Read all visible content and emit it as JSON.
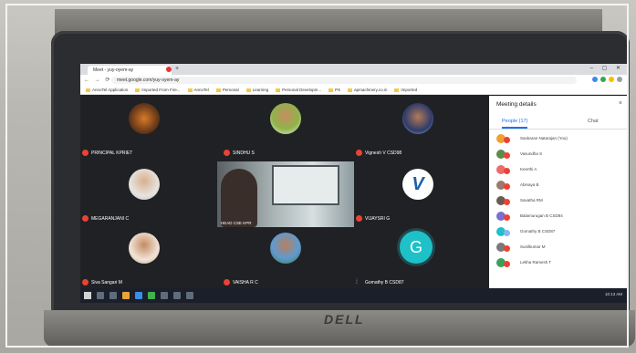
{
  "browser": {
    "tab_title": "Meet - yuy-oyem-ay",
    "url": "meet.google.com/yuy-oyem-ay",
    "bookmarks": [
      "AnnoTel Application",
      "Imported From Fire...",
      "AnnoTel",
      "Personal",
      "Learning",
      "Personal Developm...",
      "PS",
      "apmachinery.co.in",
      "Imported"
    ]
  },
  "meeting": {
    "tiles": [
      {
        "name": "PRINCIPAL KPRIET"
      },
      {
        "name": "SINDHU S"
      },
      {
        "name": "Vignesh V CSD98"
      },
      {
        "name": "MEGARANJANI C"
      },
      {
        "name": "VIJAYSRI G"
      },
      {
        "name": "Siva Sangari M"
      },
      {
        "name": "VAISHA R C"
      },
      {
        "name": "Gomathy B CSD87"
      }
    ],
    "featured_name": "HEAD CSE KPR",
    "g_letter": "G",
    "v_letter": "V"
  },
  "panel": {
    "title": "Meeting details",
    "close": "×",
    "tab_people": "People (17)",
    "tab_chat": "Chat",
    "participants": [
      "Sankaran Natarajan (You)",
      "Vasundha S",
      "Keerthi A",
      "Abinaya B",
      "Savatha RM",
      "Balamurugan B CSD84",
      "Gomathy B CSD87",
      "Sunilkumar M",
      "Lekha Ramesh T"
    ]
  },
  "taskbar": {
    "tray_time": "10:13 AM"
  },
  "laptop": {
    "brand": "DELL"
  }
}
